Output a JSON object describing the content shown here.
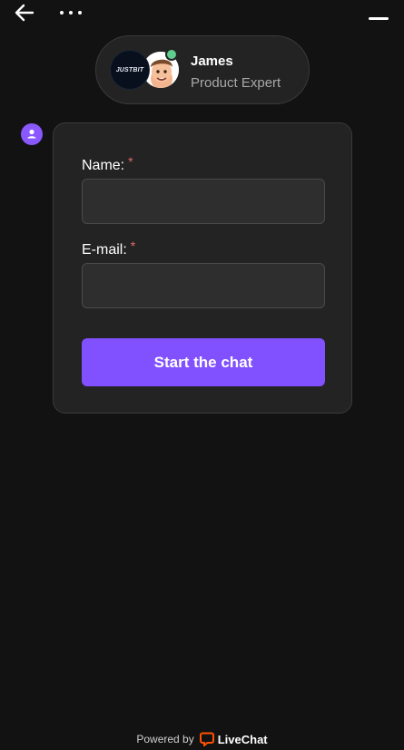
{
  "header": {
    "back_icon": "arrow-left-icon",
    "more_icon": "more-horizontal-icon",
    "minimize_icon": "minimize-icon"
  },
  "agent": {
    "brand_logo_text": "JUSTBIT",
    "name": "James",
    "role": "Product Expert",
    "status": "online",
    "status_color": "#5fcd8e"
  },
  "form": {
    "name_label": "Name:",
    "email_label": "E-mail:",
    "required_marker": "*",
    "name_value": "",
    "email_value": "",
    "submit_label": "Start the chat"
  },
  "footer": {
    "powered_by": "Powered by",
    "brand": "LiveChat"
  },
  "colors": {
    "background": "#121212",
    "card": "#232323",
    "accent": "#8150ff",
    "required": "#e06a6a",
    "livechat_orange": "#ff5100"
  }
}
